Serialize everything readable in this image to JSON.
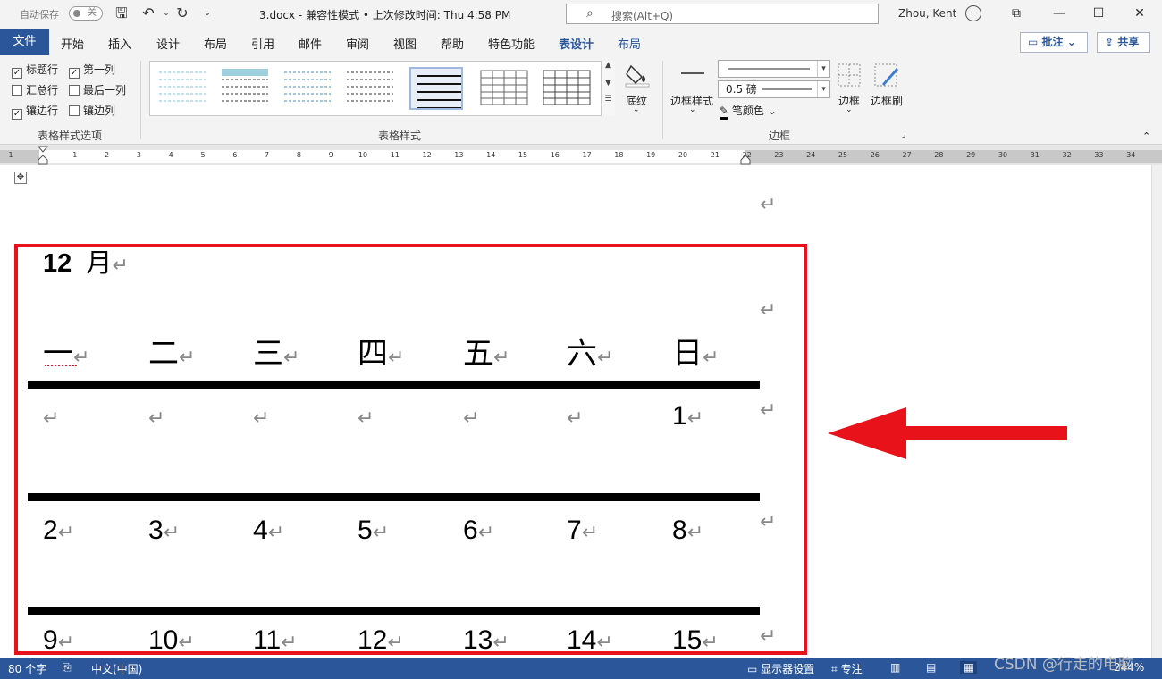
{
  "titlebar": {
    "autosave_label": "自动保存",
    "autosave_state": "关",
    "doc_title": "3.docx  -  兼容性模式 • 上次修改时间: Thu 4:58 PM",
    "search_placeholder": "搜索(Alt+Q)",
    "user_name": "Zhou, Kent"
  },
  "ribbon_tabs": {
    "file": "文件",
    "items": [
      "开始",
      "插入",
      "设计",
      "布局",
      "引用",
      "邮件",
      "审阅",
      "视图",
      "帮助",
      "特色功能",
      "表设计",
      "布局"
    ],
    "active": "表设计",
    "comment_button": "批注",
    "share_button": "共享"
  },
  "ribbon": {
    "style_options": {
      "header_row": "标题行",
      "first_column": "第一列",
      "total_row": "汇总行",
      "last_column": "最后一列",
      "banded_rows": "镶边行",
      "banded_columns": "镶边列",
      "group_label": "表格样式选项",
      "checked": [
        "标题行",
        "第一列",
        "镶边行"
      ]
    },
    "table_styles_label": "表格样式",
    "shading_label": "底纹",
    "border_styles_label": "边框样式",
    "pen_weight": "0.5 磅",
    "pen_color_label": "笔颜色",
    "borders_label": "边框",
    "border_painter_label": "边框刷",
    "borders_group_label": "边框"
  },
  "ruler_numbers": [
    "1",
    "1",
    "2",
    "3",
    "4",
    "5",
    "6",
    "7",
    "8",
    "9",
    "10",
    "11",
    "12",
    "13",
    "14",
    "15",
    "16",
    "17",
    "18",
    "19",
    "20",
    "21",
    "22",
    "23",
    "24",
    "25",
    "26",
    "27",
    "28",
    "29",
    "30",
    "31",
    "32",
    "33",
    "34"
  ],
  "document": {
    "month_number": "12",
    "month_unit": "月",
    "weekdays": [
      "一",
      "二",
      "三",
      "四",
      "五",
      "六",
      "日"
    ],
    "rows": [
      [
        "",
        "",
        "",
        "",
        "",
        "",
        "1"
      ],
      [
        "2",
        "3",
        "4",
        "5",
        "6",
        "7",
        "8"
      ],
      [
        "9",
        "10",
        "11",
        "12",
        "13",
        "14",
        "15"
      ]
    ]
  },
  "statusbar": {
    "word_count": "80 个字",
    "language": "中文(中国)",
    "display_settings": "显示器设置",
    "focus": "专注",
    "zoom": "244%"
  },
  "watermark": "CSDN @行走的电脑",
  "colors": {
    "word_blue": "#2b579a",
    "annotation_red": "#e8121b"
  }
}
